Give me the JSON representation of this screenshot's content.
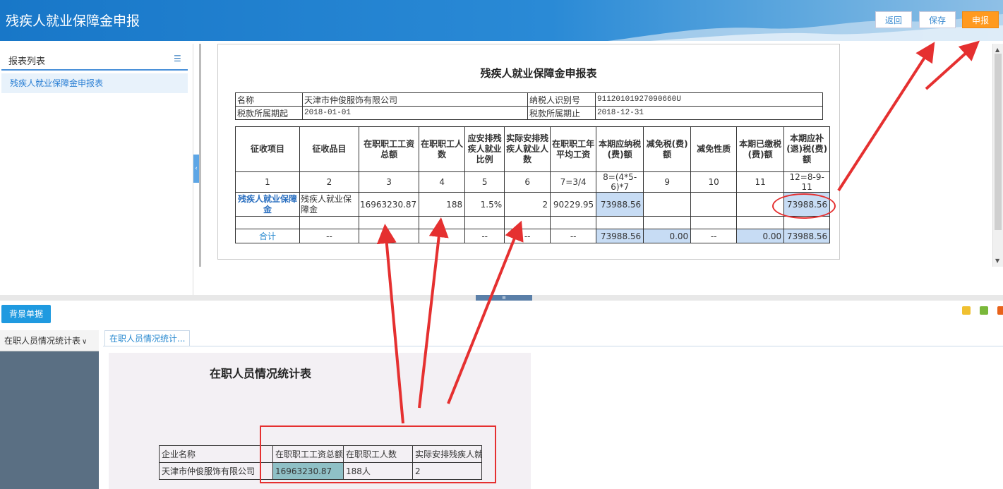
{
  "header": {
    "title": "残疾人就业保障金申报",
    "buttons": {
      "back": "返回",
      "save": "保存",
      "submit": "申报"
    }
  },
  "sidebar": {
    "title": "报表列表",
    "items": [
      {
        "label": "残疾人就业保障金申报表"
      }
    ]
  },
  "form": {
    "title": "残疾人就业保障金申报表",
    "info": {
      "name_label": "名称",
      "name_value": "天津市仲俊服饰有限公司",
      "taxid_label": "纳税人识别号",
      "taxid_value": "91120101927090660U",
      "period_start_label": "税款所属期起",
      "period_start_value": "2018-01-01",
      "period_end_label": "税款所属期止",
      "period_end_value": "2018-12-31"
    },
    "columns": [
      "征收项目",
      "征收品目",
      "在职职工工资总额",
      "在职职工人数",
      "应安排残疾人就业比例",
      "实际安排残疾人就业人数",
      "在职职工年平均工资",
      "本期应纳税(费)额",
      "减免税(费)额",
      "减免性质",
      "本期已缴税(费)额",
      "本期应补(退)税(费)额"
    ],
    "col_numbers": [
      "1",
      "2",
      "3",
      "4",
      "5",
      "6",
      "7=3/4",
      "8=(4*5-6)*7",
      "9",
      "10",
      "11",
      "12=8-9-11"
    ],
    "row": {
      "item": "残疾人就业保障金",
      "subitem": "残疾人就业保障金",
      "total_wage": "16963230.87",
      "employees": "188",
      "ratio": "1.5%",
      "disabled_count": "2",
      "avg_wage": "90229.95",
      "payable": "73988.56",
      "relief": "",
      "relief_type": "",
      "paid": "",
      "due": "73988.56"
    },
    "total": {
      "label": "合计",
      "c2": "--",
      "c3": "--",
      "c4": "--",
      "c5": "--",
      "c6": "--",
      "c7": "--",
      "payable": "73988.56",
      "relief": "0.00",
      "relief_type": "--",
      "paid": "0.00",
      "due": "73988.56"
    }
  },
  "bottom": {
    "bg_button": "背景单据",
    "nav_header": "在职人员情况统计表",
    "tab_label": "在职人员情况统计...",
    "scan": {
      "title": "在职人员情况统计表",
      "headers": [
        "企业名称",
        "在职职工工资总额",
        "在职职工人数",
        "实际安排残疾人就"
      ],
      "row": [
        "天津市仲俊服饰有限公司",
        "16963230.87",
        "188人",
        "2"
      ]
    }
  },
  "colors": {
    "header_blue": "#1877c8",
    "submit_orange": "#ff9a1f",
    "annotation_red": "#e53030",
    "cell_blue": "#c7dcf4"
  }
}
